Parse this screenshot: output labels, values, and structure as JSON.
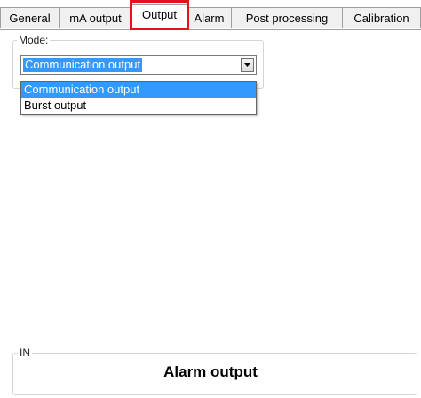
{
  "tabs": [
    {
      "label": "General"
    },
    {
      "label": "mA output"
    },
    {
      "label": "Output",
      "active": true
    },
    {
      "label": "Alarm"
    },
    {
      "label": "Post processing"
    },
    {
      "label": "Calibration"
    }
  ],
  "mode_group": {
    "caption": "Mode:",
    "combo_value": "Communication output",
    "options": [
      {
        "label": "Communication output",
        "selected": true
      },
      {
        "label": "Burst output",
        "selected": false
      }
    ]
  },
  "in_group": {
    "caption": "IN",
    "title": "Alarm output"
  },
  "colors": {
    "highlight": "#e8101a",
    "selection": "#3399ff"
  }
}
